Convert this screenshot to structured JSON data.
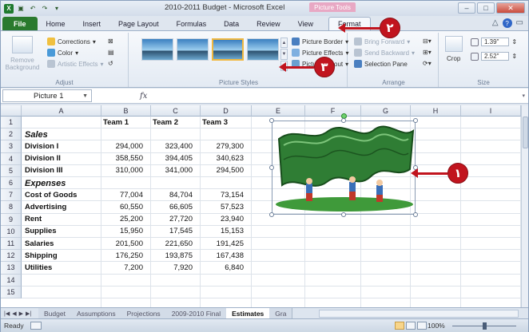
{
  "window": {
    "title": "2010-2011 Budget - Microsoft Excel",
    "context_tab": "Picture Tools"
  },
  "tabs": [
    "File",
    "Home",
    "Insert",
    "Page Layout",
    "Formulas",
    "Data",
    "Review",
    "View",
    "Format"
  ],
  "active_tab": "Format",
  "ribbon": {
    "adjust": {
      "remove_background": "Remove Background",
      "corrections": "Corrections",
      "color": "Color",
      "artistic_effects": "Artistic Effects",
      "label": "Adjust"
    },
    "picture_styles": {
      "picture_border": "Picture Border",
      "picture_effects": "Picture Effects",
      "picture_layout": "Picture Layout",
      "label": "Picture Styles"
    },
    "arrange": {
      "bring_forward": "Bring Forward",
      "send_backward": "Send Backward",
      "selection_pane": "Selection Pane",
      "label": "Arrange"
    },
    "size": {
      "crop": "Crop",
      "height": "1.39\"",
      "width": "2.52\"",
      "label": "Size"
    }
  },
  "formula_bar": {
    "name_box": "Picture 1",
    "fx": "fx"
  },
  "columns": [
    "A",
    "B",
    "C",
    "D",
    "E",
    "F",
    "G",
    "H",
    "I"
  ],
  "rows": [
    "1",
    "2",
    "3",
    "4",
    "5",
    "6",
    "7",
    "8",
    "9",
    "10",
    "11",
    "12",
    "13",
    "14",
    "15"
  ],
  "sheet": {
    "headers": [
      "Team 1",
      "Team 2",
      "Team 3"
    ],
    "sales_label": "Sales",
    "sales": [
      {
        "label": "Division I",
        "v": [
          "294,000",
          "323,400",
          "279,300"
        ]
      },
      {
        "label": "Division II",
        "v": [
          "358,550",
          "394,405",
          "340,623"
        ]
      },
      {
        "label": "Division III",
        "v": [
          "310,000",
          "341,000",
          "294,500"
        ]
      }
    ],
    "expenses_label": "Expenses",
    "expenses": [
      {
        "label": "Cost of Goods",
        "v": [
          "77,004",
          "84,704",
          "73,154"
        ]
      },
      {
        "label": "Advertising",
        "v": [
          "60,550",
          "66,605",
          "57,523"
        ]
      },
      {
        "label": "Rent",
        "v": [
          "25,200",
          "27,720",
          "23,940"
        ]
      },
      {
        "label": "Supplies",
        "v": [
          "15,950",
          "17,545",
          "15,153"
        ]
      },
      {
        "label": "Salaries",
        "v": [
          "201,500",
          "221,650",
          "191,425"
        ]
      },
      {
        "label": "Shipping",
        "v": [
          "176,250",
          "193,875",
          "167,438"
        ]
      },
      {
        "label": "Utilities",
        "v": [
          "7,200",
          "7,920",
          "6,840"
        ]
      }
    ]
  },
  "sheet_tabs": [
    "Budget",
    "Assumptions",
    "Projections",
    "2009-2010 Final",
    "Estimates",
    "Gra"
  ],
  "active_sheet": "Estimates",
  "status": {
    "ready": "Ready",
    "zoom": "100%"
  },
  "markers": {
    "one": "١",
    "two": "٢",
    "three": "٣"
  },
  "colors": {
    "file_tab": "#2a7a2e",
    "marker": "#c1141e",
    "context_tab": "#e8a8c4"
  }
}
